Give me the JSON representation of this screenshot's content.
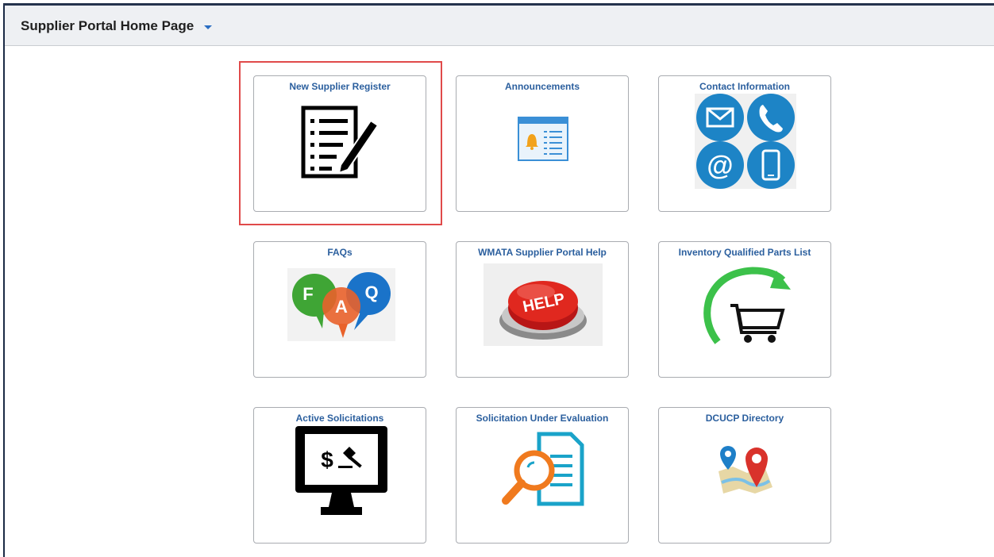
{
  "header": {
    "title": "Supplier Portal Home Page"
  },
  "tiles": [
    {
      "label": "New Supplier Register",
      "icon": "register-form-icon"
    },
    {
      "label": "Announcements",
      "icon": "announcement-bell-icon"
    },
    {
      "label": "Contact Information",
      "icon": "contact-icons"
    },
    {
      "label": "FAQs",
      "icon": "faq-bubbles-icon"
    },
    {
      "label": "WMATA Supplier Portal Help",
      "icon": "help-button-icon"
    },
    {
      "label": "Inventory Qualified Parts List",
      "icon": "cart-refresh-icon"
    },
    {
      "label": "Active Solicitations",
      "icon": "auction-monitor-icon"
    },
    {
      "label": "Solicitation Under Evaluation",
      "icon": "document-magnifier-icon"
    },
    {
      "label": "DCUCP Directory",
      "icon": "map-pins-icon"
    }
  ],
  "faq_letters": {
    "f": "F",
    "a": "A",
    "q": "Q"
  },
  "help_text": "HELP",
  "auction_text": "$",
  "colors": {
    "accent": "#2b5f9e",
    "highlight": "#e04a4a",
    "header_bg": "#eef0f3"
  }
}
